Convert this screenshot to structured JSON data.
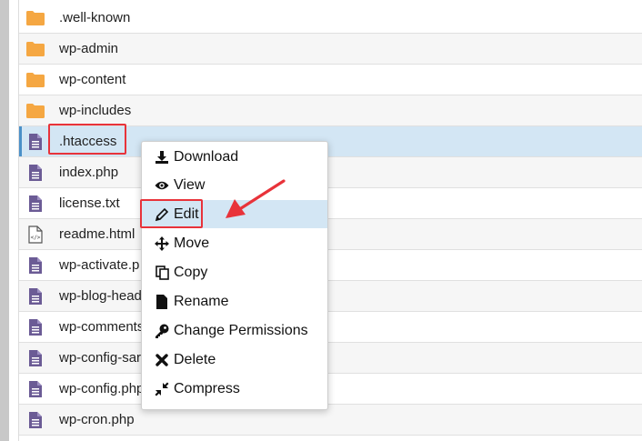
{
  "file_list": {
    "items": [
      {
        "name": ".well-known",
        "type": "folder"
      },
      {
        "name": "wp-admin",
        "type": "folder"
      },
      {
        "name": "wp-content",
        "type": "folder"
      },
      {
        "name": "wp-includes",
        "type": "folder"
      },
      {
        "name": ".htaccess",
        "type": "file",
        "selected": true
      },
      {
        "name": "index.php",
        "type": "file"
      },
      {
        "name": "license.txt",
        "type": "file"
      },
      {
        "name": "readme.html",
        "type": "html"
      },
      {
        "name": "wp-activate.p",
        "type": "file"
      },
      {
        "name": "wp-blog-head",
        "type": "file"
      },
      {
        "name": "wp-comments",
        "type": "file"
      },
      {
        "name": "wp-config-sar",
        "type": "file"
      },
      {
        "name": "wp-config.php",
        "type": "file"
      },
      {
        "name": "wp-cron.php",
        "type": "file"
      }
    ]
  },
  "context_menu": {
    "items": [
      {
        "label": "Download",
        "icon": "download-icon"
      },
      {
        "label": "View",
        "icon": "eye-icon"
      },
      {
        "label": "Edit",
        "icon": "pencil-icon",
        "highlighted": true
      },
      {
        "label": "Move",
        "icon": "move-arrows-icon"
      },
      {
        "label": "Copy",
        "icon": "copy-icon"
      },
      {
        "label": "Rename",
        "icon": "file-icon"
      },
      {
        "label": "Change Permissions",
        "icon": "key-icon"
      },
      {
        "label": "Delete",
        "icon": "close-x-icon"
      },
      {
        "label": "Compress",
        "icon": "compress-icon"
      }
    ]
  },
  "colors": {
    "folder": "#f5a742",
    "file": "#6b5b95",
    "selection": "#d3e6f4",
    "annotation": "#e8333a"
  }
}
